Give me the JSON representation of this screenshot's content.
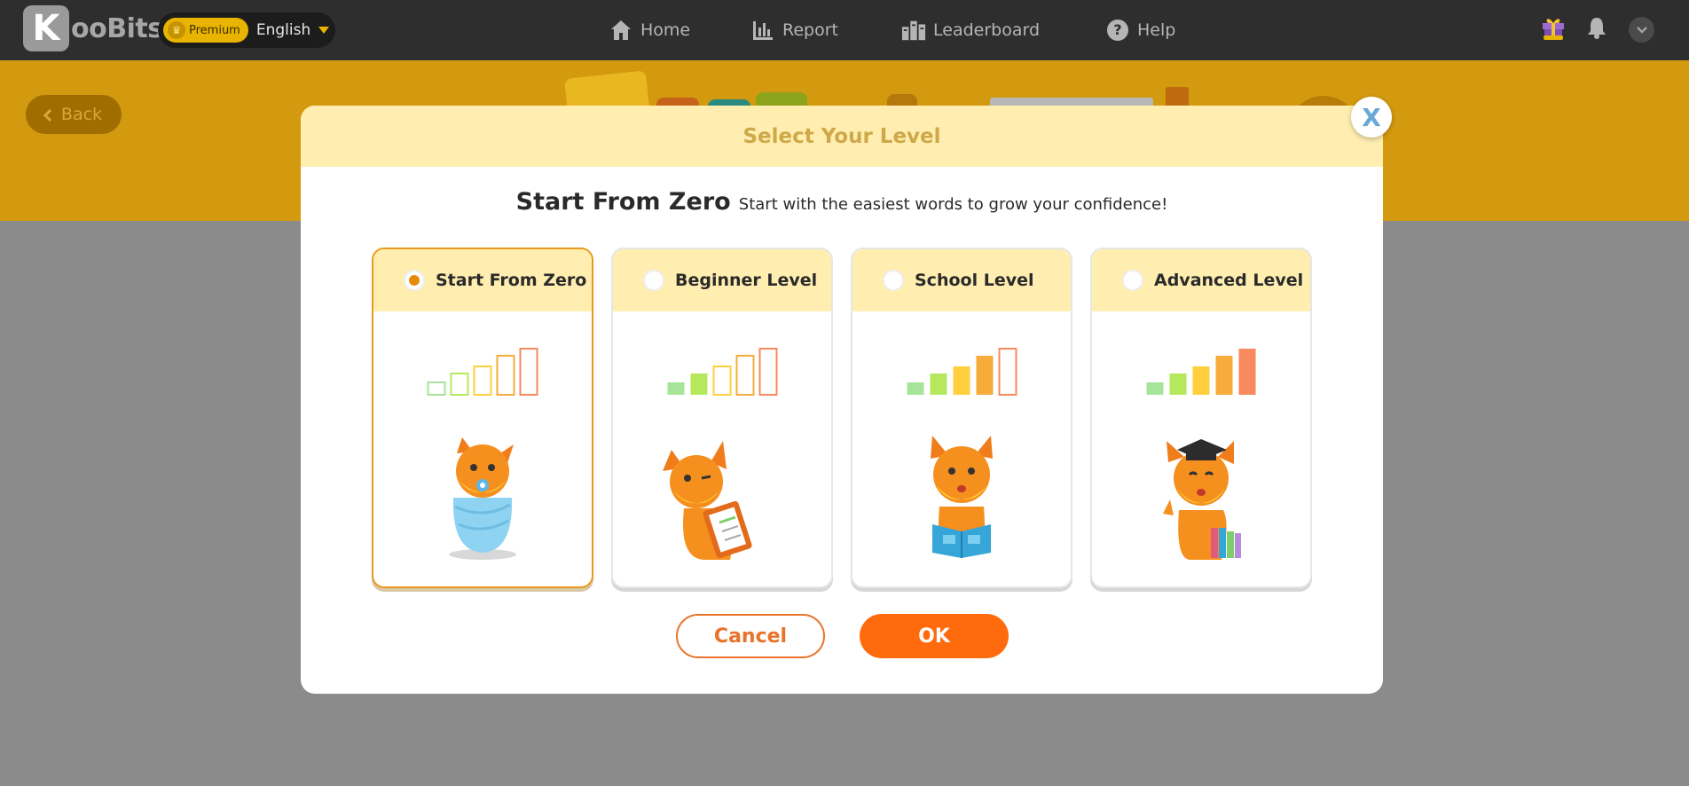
{
  "app": {
    "logo_letter": "K",
    "logo_text": "ooBits",
    "premium_label": "Premium",
    "language": "English"
  },
  "nav": {
    "items": [
      {
        "label": "Home",
        "icon": "home-icon"
      },
      {
        "label": "Report",
        "icon": "report-icon"
      },
      {
        "label": "Leaderboard",
        "icon": "leaderboard-icon"
      },
      {
        "label": "Help",
        "icon": "help-icon"
      }
    ]
  },
  "header_icons": [
    "gift-icon",
    "bell-icon",
    "account-dropdown-icon"
  ],
  "back_label": "Back",
  "modal": {
    "title": "Select Your Level",
    "close_glyph": "X",
    "selected_name": "Start From Zero",
    "selected_description": "Start with the easiest words to grow your confidence!",
    "levels": [
      {
        "label": "Start From Zero",
        "selected": true,
        "filled_bars": 0,
        "mascot": "baby-fox-icon"
      },
      {
        "label": "Beginner Level",
        "selected": false,
        "filled_bars": 2,
        "mascot": "fox-clipboard-icon"
      },
      {
        "label": "School Level",
        "selected": false,
        "filled_bars": 4,
        "mascot": "fox-reading-icon"
      },
      {
        "label": "Advanced Level",
        "selected": false,
        "filled_bars": 5,
        "mascot": "fox-graduate-icon"
      }
    ],
    "cancel_label": "Cancel",
    "ok_label": "OK"
  },
  "colors": {
    "accent": "#ff6a0d",
    "modal_header": "#ffeeb0",
    "selected_border": "#e99a1c",
    "bar_colors": [
      "#a6e49a",
      "#b6e85e",
      "#ffcf3d",
      "#f7ab3a",
      "#f78a5e"
    ]
  }
}
